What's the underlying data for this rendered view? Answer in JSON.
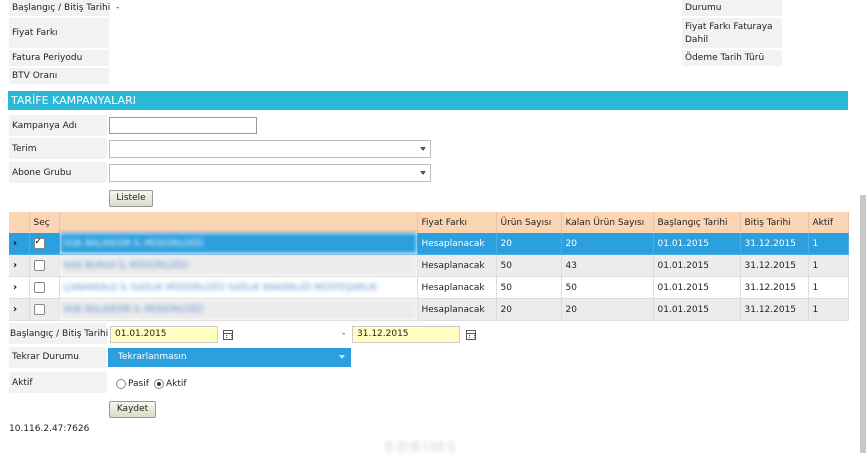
{
  "top_left": [
    {
      "label": "Başlangıç / Bitiş Tarihi",
      "value": "-"
    },
    {
      "label": "Fiyat Farkı",
      "value": ""
    },
    {
      "label": "Fatura Periyodu",
      "value": ""
    },
    {
      "label": "BTV Oranı",
      "value": ""
    }
  ],
  "top_right": [
    "Durumu",
    "Fiyat Farkı Faturaya Dahil",
    "Ödeme Tarih Türü"
  ],
  "section_title": "TARİFE KAMPANYALARI",
  "form": {
    "campaign_name_label": "Kampanya Adı",
    "campaign_name_value": "",
    "term_label": "Terim",
    "term_value": "",
    "subscriber_group_label": "Abone Grubu",
    "subscriber_group_value": "",
    "list_button": "Listele"
  },
  "grid": {
    "columns": [
      "",
      "Seç",
      "",
      "Fiyat Farkı",
      "Ürün Sayısı",
      "Kalan Ürün Sayısı",
      "Başlangıç Tarihi",
      "Bitiş Tarihi",
      "Aktif"
    ],
    "rows": [
      {
        "checked": true,
        "name": "SGK BALIKESİR İL MÜDÜRLÜĞÜ",
        "price_diff": "Hesaplanacak",
        "product_count": "20",
        "remaining": "20",
        "start": "01.01.2015",
        "end": "31.12.2015",
        "active": "1"
      },
      {
        "checked": false,
        "name": "SGK BURSA İL MÜDÜRLÜĞÜ",
        "price_diff": "Hesaplanacak",
        "product_count": "50",
        "remaining": "43",
        "start": "01.01.2015",
        "end": "31.12.2015",
        "active": "1"
      },
      {
        "checked": false,
        "name": "ÇANAKKALE İL SAĞLIK MÜDÜRLÜĞÜ SAĞLIK BAKANLIĞI MÜSTEŞARLIK",
        "price_diff": "Hesaplanacak",
        "product_count": "50",
        "remaining": "50",
        "start": "01.01.2015",
        "end": "31.12.2015",
        "active": "1"
      },
      {
        "checked": false,
        "name": "SGK BALIKESİR İL MÜDÜRLÜĞÜ",
        "price_diff": "Hesaplanacak",
        "product_count": "20",
        "remaining": "20",
        "start": "01.01.2015",
        "end": "31.12.2015",
        "active": "1"
      }
    ]
  },
  "bottom": {
    "date_label": "Başlangıç / Bitiş Tarihi",
    "start_date": "01.01.2015",
    "separator": "-",
    "end_date": "31.12.2015",
    "repeat_label": "Tekrar Durumu",
    "repeat_value": "Tekrarlanmasın",
    "active_label": "Aktif",
    "radio_passive": "Pasif",
    "radio_active": "Aktif",
    "radio_selected": "Aktif",
    "save_button": "Kaydet"
  },
  "footer_ip": "10.116.2.47:7626",
  "watermark": "EDRIMS",
  "colors": {
    "accent": "#29b9d6",
    "selected_row": "#2c9fde",
    "header_row": "#fcd5b4",
    "date_bg": "#ffffc2"
  }
}
